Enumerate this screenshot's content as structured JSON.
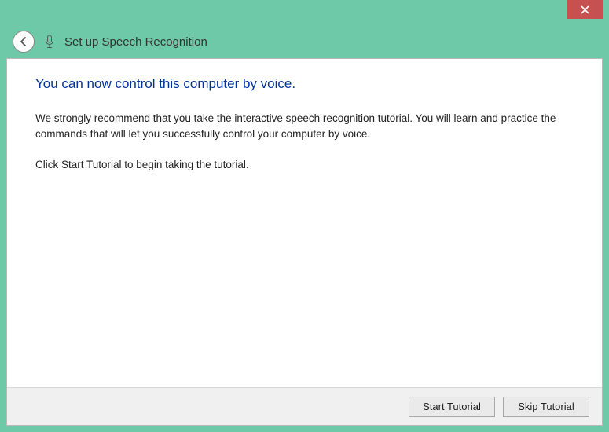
{
  "window": {
    "title": "Set up Speech Recognition"
  },
  "main": {
    "heading": "You can now control this computer by voice.",
    "paragraph1": "We strongly recommend that you take the interactive speech recognition tutorial. You will learn and practice the commands that will let you successfully control your computer by voice.",
    "paragraph2": "Click Start Tutorial to begin taking the tutorial."
  },
  "footer": {
    "primary_label": "Start Tutorial",
    "secondary_label": "Skip Tutorial"
  }
}
